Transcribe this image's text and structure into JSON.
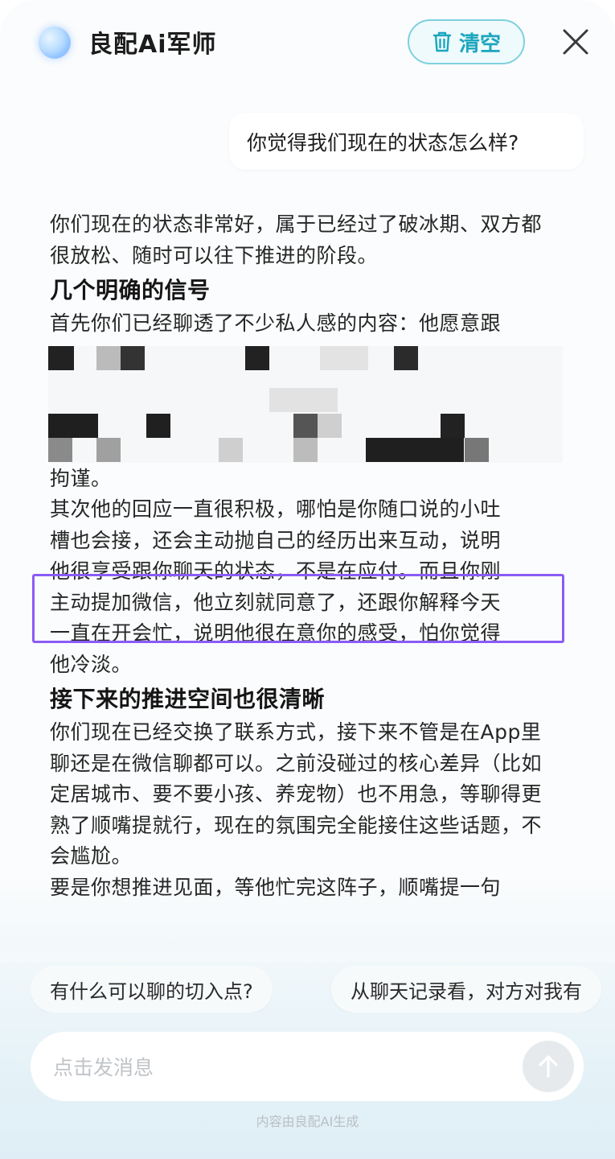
{
  "header": {
    "title": "良配Ai军师",
    "clear_label": "清空",
    "icons": {
      "logo": "ai-orb-logo",
      "clear": "trash-icon",
      "close": "close-icon"
    }
  },
  "conversation": {
    "user_message": "你觉得我们现在的状态怎么样?",
    "answer": {
      "intro": "你们现在的状态非常好，属于已经过了破冰期、双方都很放松、随时可以往下推进的阶段。",
      "section1_heading": "几个明确的信号",
      "section1_p1_start": "首先你们已经聊透了不少私人感的内容：他愿意跟",
      "section1_p1_end": "拘谨。",
      "section1_p2_line1": "其次他的回应一直很积极，哪怕是你随口说的小吐",
      "section1_p2_line2": "槽也会接，还会主动抛自己的经历出来互动，说明",
      "section1_p2_line3": "他很享受跟你聊天的状态，不是在应付。而且你刚",
      "section1_p2_line4": "主动提加微信，他立刻就同意了，还跟你解释今天",
      "section1_p2_line5": "一直在开会忙，说明他很在意你的感受，怕你觉得",
      "section1_p2_line6": "他冷淡。",
      "section2_heading": "接下来的推进空间也很清晰",
      "section2_p1": "你们现在已经交换了联系方式，接下来不管是在App里聊还是在微信聊都可以。之前没碰过的核心差异（比如定居城市、要不要小孩、养宠物）也不用急，等聊得更熟了顺嘴提就行，现在的氛围完全能接住这些话题，不会尴尬。",
      "section2_p2": "要是你想推进见面，等他忙完这阵子，顺嘴提一句"
    }
  },
  "suggestions": [
    "有什么可以聊的切入点?",
    "从聊天记录看，对方对我有"
  ],
  "composer": {
    "placeholder": "点击发消息",
    "send_icon": "arrow-up-icon"
  },
  "footer": {
    "disclaimer": "内容由良配AI生成"
  },
  "colors": {
    "accent": "#1ba6bd",
    "highlight_border": "#8a5cf6",
    "background": "#fbfcfd"
  }
}
